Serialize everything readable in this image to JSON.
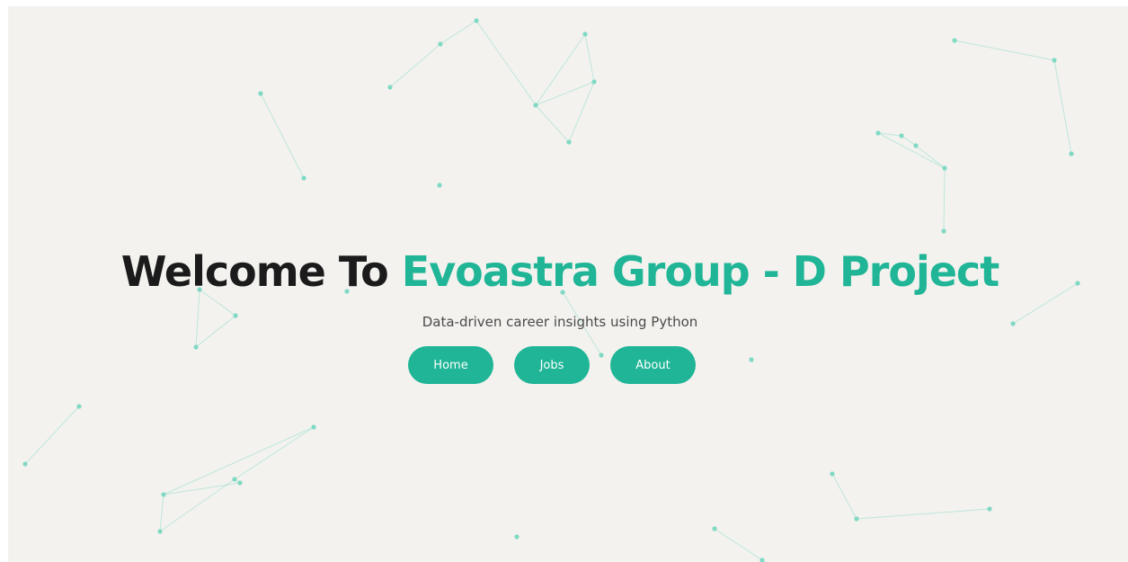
{
  "hero": {
    "title_prefix": "Welcome To ",
    "title_highlight": "Evoastra Group - D Project",
    "subtitle": "Data-driven career insights using Python"
  },
  "nav": {
    "home_label": "Home",
    "jobs_label": "Jobs",
    "about_label": "About"
  },
  "colors": {
    "background": "#f3f2ef",
    "accent": "#1fb596",
    "heading": "#1b1b1b",
    "subtitle": "#4a4a4a",
    "particle": "#7fd9c3"
  }
}
